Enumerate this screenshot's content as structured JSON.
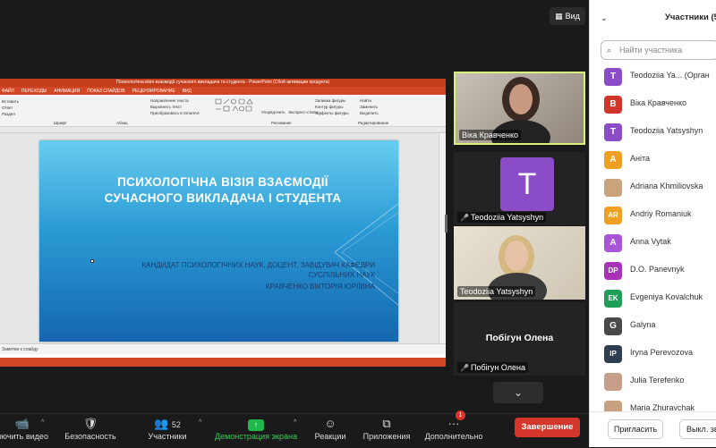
{
  "top_bar": {
    "view_label": "Вид"
  },
  "ppt": {
    "window_title": "Психологічна візія взаємодії сучасного викладача та студента - PowerPoint (Сбой активации продукта)",
    "tabs": [
      "ФАЙЛ",
      "ПЕРЕХОДЫ",
      "АНИМАЦИЯ",
      "ПОКАЗ СЛАЙДОВ",
      "РЕЦЕНЗИРОВАНИЕ",
      "ВИД"
    ],
    "ribbon": {
      "paste": "Вставить",
      "cut": "Ответ",
      "copy": "Обновить",
      "section": "Раздел",
      "group_clipboard": "Шрифт",
      "group_paragraph": "Абзац",
      "group_drawing": "Рисование",
      "group_editing": "Редактирование",
      "text_direction": "Направление текста",
      "align_text": "Выровнять текст",
      "convert_smartart": "Преобразовать в SmartArt",
      "arrange": "Упорядочить",
      "quick_styles": "Экспресс-стили",
      "shape_fill": "Заливка фигуры",
      "shape_outline": "Контур фигуры",
      "shape_effects": "Эффекты фигуры",
      "find": "Найти",
      "replace": "Заменить",
      "select": "Выделить"
    },
    "slide": {
      "title_line1": "ПСИХОЛОГІЧНА ВІЗІЯ ВЗАЄМОДІЇ",
      "title_line2": "СУЧАСНОГО ВИКЛАДАЧА І СТУДЕНТА",
      "sub_line1": "КАНДИДАТ ПСИХОЛОГІЧНИХ НАУК, ДОЦЕНТ, ЗАВІДУВАЧ КАФЕДРИ",
      "sub_line2": "СУСПІЛЬНИХ НАУК",
      "sub_line3": "КРАВЧЕНКО ВІКТОРІЯ ЮРІЇВНА"
    },
    "notes_placeholder": "Заметки к слайду"
  },
  "gallery": {
    "tiles": [
      {
        "name": "Віка Кравченко",
        "muted": false
      },
      {
        "name": "Teodoziia Yatsyshyn",
        "muted": true,
        "avatar_letter": "T"
      },
      {
        "name": "Teodoziia Yatsyshyn",
        "muted": false
      },
      {
        "name": "Побігун Олена",
        "muted": true,
        "center_name": "Побігун Олена"
      }
    ]
  },
  "toolbar": {
    "video": "Включить видео",
    "security": "Безопасность",
    "participants": "Участники",
    "participants_count": "52",
    "share": "Демонстрация экрана",
    "reactions": "Реакции",
    "apps": "Приложения",
    "more": "Дополнительно",
    "more_badge": "1",
    "end": "Завершение"
  },
  "panel": {
    "title": "Участники (5",
    "search_placeholder": "Найти участника",
    "participants": [
      {
        "initials": "T",
        "name": "Teodoziia Ya...  (Орган",
        "color": "#8b4cc7"
      },
      {
        "initials": "В",
        "name": "Віка Кравченко",
        "color": "#d0352a"
      },
      {
        "initials": "T",
        "name": "Teodoziia Yatsyshyn",
        "color": "#8b4cc7"
      },
      {
        "initials": "А",
        "name": "Аніта",
        "color": "#f0a020"
      },
      {
        "initials": "",
        "name": "Adriana Khmiliovska",
        "color": "#caa27c"
      },
      {
        "initials": "AR",
        "name": "Andriy Romaniuk",
        "color": "#f0a020"
      },
      {
        "initials": "A",
        "name": "Anna Vytak",
        "color": "#a855d8"
      },
      {
        "initials": "DP",
        "name": "D.O. Panevnyk",
        "color": "#a833b8"
      },
      {
        "initials": "EK",
        "name": "Evgeniya Kovalchuk",
        "color": "#1f9e5a"
      },
      {
        "initials": "G",
        "name": "Galyna",
        "color": "#4a4a4a"
      },
      {
        "initials": "IP",
        "name": "Iryna Perevozova",
        "color": "#2c3e50"
      },
      {
        "initials": "",
        "name": "Julia Terefenko",
        "color": "#c69f8a"
      },
      {
        "initials": "",
        "name": "Maria Zhuravchak",
        "color": "#c9a07f"
      }
    ],
    "invite": "Пригласить",
    "mute_all": "Выкл. звук"
  }
}
